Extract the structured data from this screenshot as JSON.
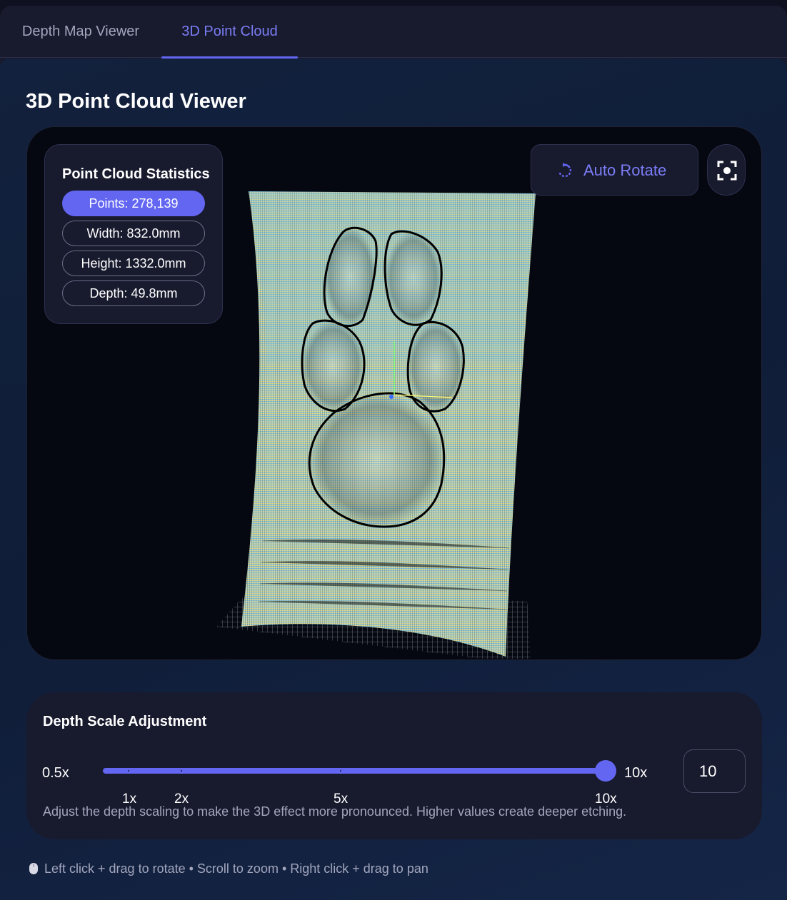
{
  "tabs": [
    {
      "label": "Depth Map Viewer",
      "active": false
    },
    {
      "label": "3D Point Cloud",
      "active": true
    }
  ],
  "panel": {
    "title": "3D Point Cloud Viewer"
  },
  "stats": {
    "title": "Point Cloud Statistics",
    "points": "Points: 278,139",
    "width": "Width: 832.0mm",
    "height": "Height: 1332.0mm",
    "depth": "Depth: 49.8mm"
  },
  "controls": {
    "auto_rotate": "Auto Rotate",
    "auto_rotate_icon": "rotate-icon",
    "focus_icon": "focus-icon"
  },
  "depth_scale": {
    "title": "Depth Scale Adjustment",
    "min_label": "0.5x",
    "max_label": "10x",
    "value": 10,
    "input_value": "10",
    "ticks": [
      "1x",
      "2x",
      "5x",
      "10x"
    ],
    "help": "Adjust the depth scaling to make the 3D effect more pronounced. Higher values create deeper etching."
  },
  "hint": {
    "icon": "mouse-icon",
    "text": "Left click + drag to rotate • Scroll to zoom • Right click + drag to pan"
  },
  "colors": {
    "accent": "#6366f1",
    "panel_bg": "#181a2e",
    "viewer_bg": "#050810",
    "cloud_top": "#6fb8d4",
    "cloud_bottom": "#e3dd88"
  }
}
